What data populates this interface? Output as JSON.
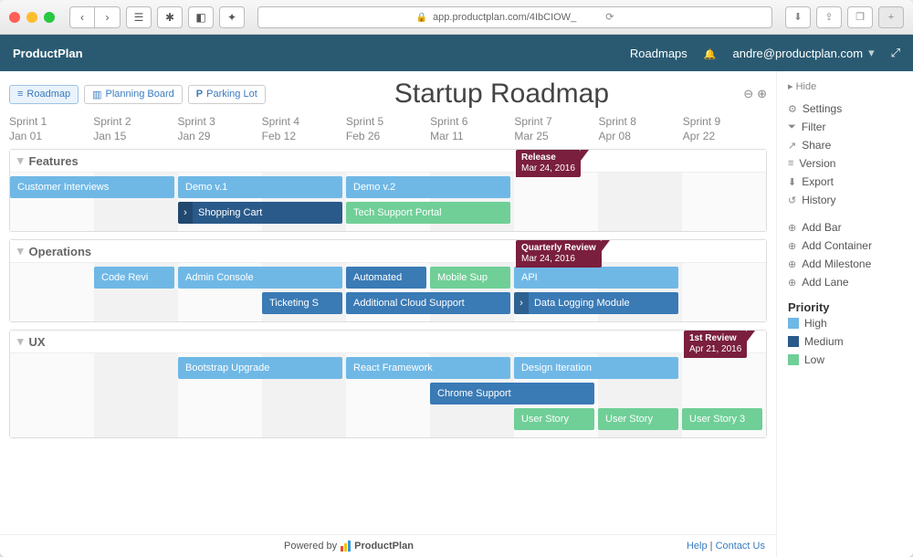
{
  "browser": {
    "url": "app.productplan.com/4IbCIOW_"
  },
  "appbar": {
    "brand": "ProductPlan",
    "nav_roadmaps": "Roadmaps",
    "user_email": "andre@productplan.com"
  },
  "tabs": {
    "roadmap": "Roadmap",
    "planning": "Planning Board",
    "parking": "Parking Lot"
  },
  "title": "Startup Roadmap",
  "sprints": [
    {
      "name": "Sprint 1",
      "date": "Jan 01"
    },
    {
      "name": "Sprint 2",
      "date": "Jan 15"
    },
    {
      "name": "Sprint 3",
      "date": "Jan 29"
    },
    {
      "name": "Sprint 4",
      "date": "Feb 12"
    },
    {
      "name": "Sprint 5",
      "date": "Feb 26"
    },
    {
      "name": "Sprint 6",
      "date": "Mar 11"
    },
    {
      "name": "Sprint 7",
      "date": "Mar 25"
    },
    {
      "name": "Sprint 8",
      "date": "Apr 08"
    },
    {
      "name": "Sprint 9",
      "date": "Apr 22"
    }
  ],
  "lanes": [
    {
      "name": "Features",
      "milestone": {
        "title": "Release",
        "date": "Mar 24, 2016",
        "col": 6
      },
      "rows": [
        [
          {
            "label": "Customer Interviews",
            "start": 0,
            "span": 2,
            "color": "c-light"
          },
          {
            "label": "Demo v.1",
            "start": 2,
            "span": 2,
            "color": "c-light"
          },
          {
            "label": "Demo v.2",
            "start": 4,
            "span": 2,
            "color": "c-light"
          }
        ],
        [
          {
            "label": "Shopping Cart",
            "start": 2,
            "span": 2,
            "color": "c-dark",
            "chev": true
          },
          {
            "label": "Tech Support Portal",
            "start": 4,
            "span": 2,
            "color": "c-green"
          }
        ]
      ]
    },
    {
      "name": "Operations",
      "milestone": {
        "title": "Quarterly Review",
        "date": "Mar 24, 2016",
        "col": 6
      },
      "rows": [
        [
          {
            "label": "Code Revi",
            "start": 1,
            "span": 1,
            "color": "c-light"
          },
          {
            "label": "Admin Console",
            "start": 2,
            "span": 2,
            "color": "c-light"
          },
          {
            "label": "Automated",
            "start": 4,
            "span": 1,
            "color": "c-med"
          },
          {
            "label": "Mobile Sup",
            "start": 5,
            "span": 1,
            "color": "c-green"
          },
          {
            "label": "API",
            "start": 6,
            "span": 2,
            "color": "c-light"
          }
        ],
        [
          {
            "label": "Ticketing S",
            "start": 3,
            "span": 1,
            "color": "c-med"
          },
          {
            "label": "Additional Cloud Support",
            "start": 4,
            "span": 2,
            "color": "c-med"
          },
          {
            "label": "Data Logging Module",
            "start": 6,
            "span": 2,
            "color": "c-med",
            "chev": true
          }
        ]
      ]
    },
    {
      "name": "UX",
      "milestone": {
        "title": "1st Review",
        "date": "Apr 21, 2016",
        "col": 8
      },
      "rows": [
        [
          {
            "label": "Bootstrap Upgrade",
            "start": 2,
            "span": 2,
            "color": "c-light"
          },
          {
            "label": "React Framework",
            "start": 4,
            "span": 2,
            "color": "c-light"
          },
          {
            "label": "Design Iteration",
            "start": 6,
            "span": 2,
            "color": "c-light"
          }
        ],
        [
          {
            "label": "Chrome Support",
            "start": 5,
            "span": 2,
            "color": "c-med"
          }
        ],
        [
          {
            "label": "User Story",
            "start": 6,
            "span": 1,
            "color": "c-green"
          },
          {
            "label": "User Story",
            "start": 7,
            "span": 1,
            "color": "c-green"
          },
          {
            "label": "User Story 3",
            "start": 8,
            "span": 1,
            "color": "c-green"
          }
        ]
      ]
    }
  ],
  "side": {
    "hide": "Hide",
    "settings": "Settings",
    "filter": "Filter",
    "share": "Share",
    "version": "Version",
    "export": "Export",
    "history": "History",
    "add_bar": "Add Bar",
    "add_container": "Add Container",
    "add_milestone": "Add Milestone",
    "add_lane": "Add Lane",
    "priority_head": "Priority",
    "p_high": "High",
    "p_med": "Medium",
    "p_low": "Low",
    "colors": {
      "high": "#6fb8e6",
      "medium": "#2a5a8a",
      "low": "#6fcf97"
    }
  },
  "footer": {
    "powered": "Powered by",
    "brand": "ProductPlan",
    "help": "Help",
    "contact": "Contact Us"
  }
}
